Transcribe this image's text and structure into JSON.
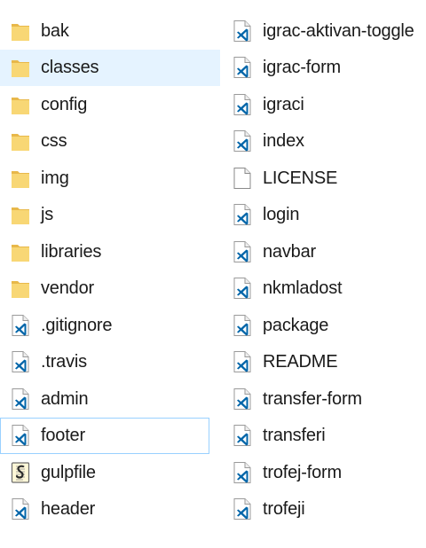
{
  "explorer": {
    "left_column": [
      {
        "name": "bak",
        "type": "folder",
        "state": ""
      },
      {
        "name": "classes",
        "type": "folder",
        "state": "hover"
      },
      {
        "name": "config",
        "type": "folder",
        "state": ""
      },
      {
        "name": "css",
        "type": "folder",
        "state": ""
      },
      {
        "name": "img",
        "type": "folder",
        "state": ""
      },
      {
        "name": "js",
        "type": "folder",
        "state": ""
      },
      {
        "name": "libraries",
        "type": "folder",
        "state": ""
      },
      {
        "name": "vendor",
        "type": "folder",
        "state": ""
      },
      {
        "name": ".gitignore",
        "type": "vscode",
        "state": ""
      },
      {
        "name": ".travis",
        "type": "vscode",
        "state": ""
      },
      {
        "name": "admin",
        "type": "vscode",
        "state": ""
      },
      {
        "name": "footer",
        "type": "vscode",
        "state": "selected"
      },
      {
        "name": "gulpfile",
        "type": "script",
        "state": ""
      },
      {
        "name": "header",
        "type": "vscode",
        "state": ""
      }
    ],
    "right_column": [
      {
        "name": "igrac-aktivan-toggle",
        "type": "vscode",
        "state": ""
      },
      {
        "name": "igrac-form",
        "type": "vscode",
        "state": ""
      },
      {
        "name": "igraci",
        "type": "vscode",
        "state": ""
      },
      {
        "name": "index",
        "type": "vscode",
        "state": ""
      },
      {
        "name": "LICENSE",
        "type": "blank",
        "state": ""
      },
      {
        "name": "login",
        "type": "vscode",
        "state": ""
      },
      {
        "name": "navbar",
        "type": "vscode",
        "state": ""
      },
      {
        "name": "nkmladost",
        "type": "vscode",
        "state": ""
      },
      {
        "name": "package",
        "type": "vscode",
        "state": ""
      },
      {
        "name": "README",
        "type": "vscode",
        "state": ""
      },
      {
        "name": "transfer-form",
        "type": "vscode",
        "state": ""
      },
      {
        "name": "transferi",
        "type": "vscode",
        "state": ""
      },
      {
        "name": "trofej-form",
        "type": "vscode",
        "state": ""
      },
      {
        "name": "trofeji",
        "type": "vscode",
        "state": ""
      }
    ]
  },
  "colors": {
    "folder": "#f8d775",
    "folder_dark": "#e8b84a",
    "vscode_blue": "#0065a9",
    "hover_bg": "#e5f3ff",
    "selected_border": "#99d1ff"
  },
  "icons": {
    "folder": "folder-icon",
    "vscode": "vscode-file-icon",
    "script": "script-file-icon",
    "blank": "blank-file-icon"
  }
}
